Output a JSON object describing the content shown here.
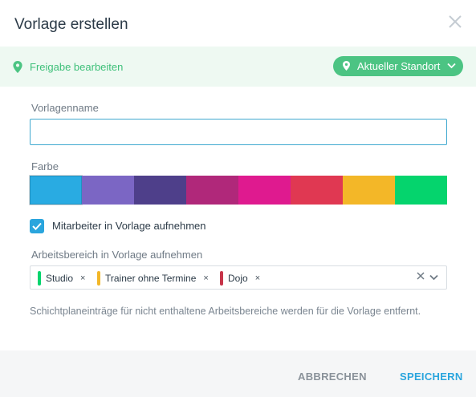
{
  "dialog": {
    "title": "Vorlage erstellen"
  },
  "share_bar": {
    "link_label": "Freigabe bearbeiten",
    "location_label": "Aktueller Standort"
  },
  "form": {
    "name_label": "Vorlagenname",
    "name_value": "",
    "color_label": "Farbe",
    "colors": [
      "#29abe2",
      "#7b66c4",
      "#4e3f8a",
      "#b0287a",
      "#df1a8f",
      "#e03852",
      "#f3b728",
      "#05d46d"
    ],
    "selected_color_index": 0,
    "include_employees_label": "Mitarbeiter in Vorlage aufnehmen",
    "include_employees_checked": true,
    "workareas_label": "Arbeitsbereich in Vorlage aufnehmen",
    "workareas": [
      {
        "name": "Studio",
        "color": "#05d46d"
      },
      {
        "name": "Trainer ohne Termine",
        "color": "#f3b728"
      },
      {
        "name": "Dojo",
        "color": "#c7354a"
      }
    ],
    "info_text": "Schichtplaneinträge für nicht enthaltene Arbeitsbereiche werden für die Vorlage entfernt."
  },
  "footer": {
    "cancel_label": "ABBRECHEN",
    "save_label": "SPEICHERN"
  },
  "colors": {
    "accent": "#2aa5dd",
    "success": "#4cc483",
    "share_bar_bg": "#eef9f2"
  }
}
